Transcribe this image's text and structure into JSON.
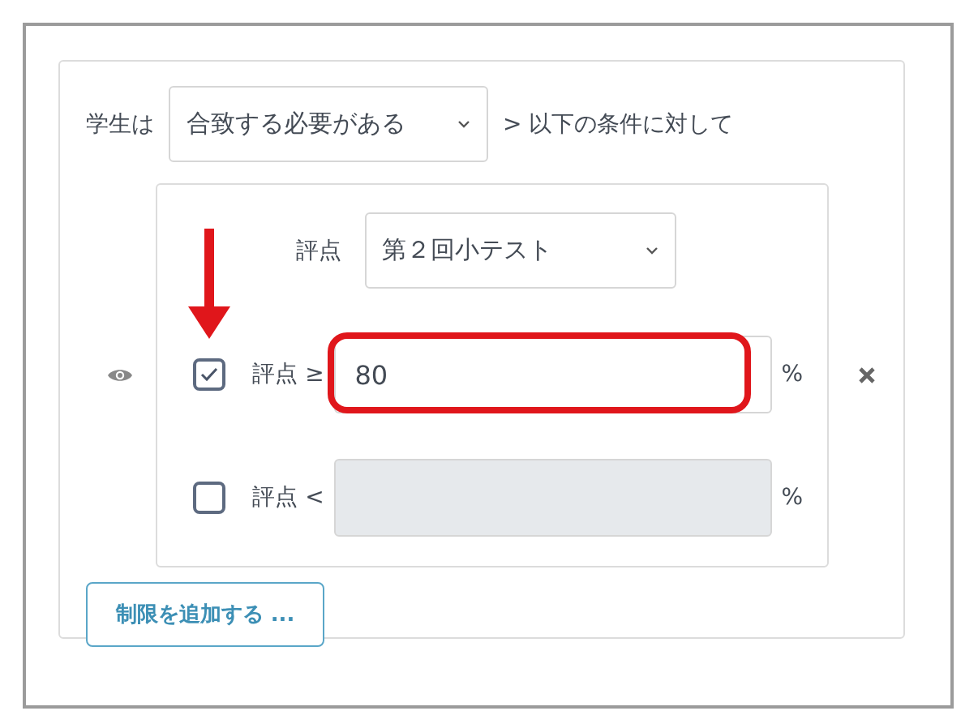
{
  "intro": {
    "label": "学生は",
    "select": "合致する必要がある",
    "suffix": "> 以下の条件に対して"
  },
  "grade_item": {
    "label": "評点",
    "select": "第２回小テスト"
  },
  "conditions": [
    {
      "label": "評点 ≥",
      "checked": true,
      "value": "80",
      "disabled": false,
      "unit": "%",
      "highlighted": true,
      "arrow": true
    },
    {
      "label": "評点 <",
      "checked": false,
      "disabled": true,
      "unit": "%",
      "highlighted": false,
      "arrow": false
    }
  ],
  "add_button": "制限を追加する ..."
}
